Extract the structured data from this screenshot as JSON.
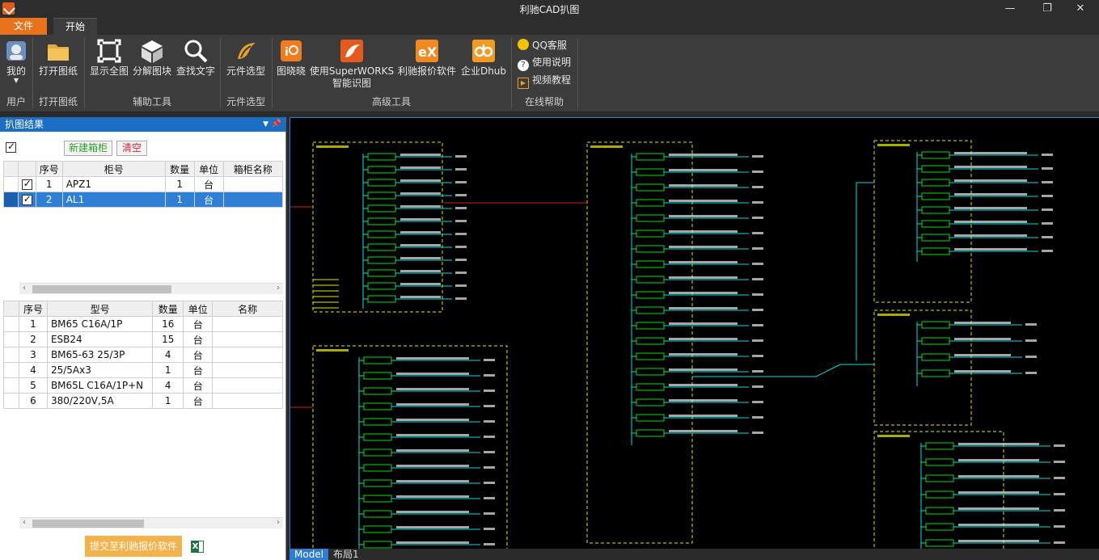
{
  "window": {
    "title": "利驰CAD扒图",
    "minimize": "—",
    "restore": "❐",
    "close": "✕"
  },
  "tabs": {
    "file": "文件",
    "start": "开始"
  },
  "ribbon": {
    "user": {
      "label": "我的",
      "group": "用户"
    },
    "open": {
      "label": "打开图纸",
      "group": "打开图纸"
    },
    "aux": {
      "show_all": "显示全图",
      "explode": "分解图块",
      "find_text": "查找文字",
      "group": "辅助工具"
    },
    "component": {
      "label": "元件选型",
      "group": "元件选型"
    },
    "advanced": {
      "tuxiaoxiao": "图晓晓",
      "superworks": "使用SuperWORKS",
      "superworks2": "智能识图",
      "quote": "利驰报价软件",
      "dhub": "企业Dhub",
      "group": "高级工具"
    },
    "help": {
      "qq": "QQ客服",
      "manual": "使用说明",
      "video": "视频教程",
      "group": "在线帮助"
    }
  },
  "panel": {
    "title": "扒图结果",
    "new_box": "新建箱柜",
    "clear": "清空",
    "cabinet_headers": [
      "序号",
      "柜号",
      "数量",
      "单位",
      "箱柜名称"
    ],
    "cabinets": [
      {
        "no": "1",
        "name": "APZ1",
        "qty": "1",
        "unit": "台",
        "box": ""
      },
      {
        "no": "2",
        "name": "AL1",
        "qty": "1",
        "unit": "台",
        "box": ""
      }
    ],
    "item_headers": [
      "序号",
      "型号",
      "数量",
      "单位",
      "名称"
    ],
    "items": [
      {
        "no": "1",
        "model": "BM65 C16A/1P",
        "qty": "16",
        "unit": "台",
        "name": ""
      },
      {
        "no": "2",
        "model": "ESB24",
        "qty": "15",
        "unit": "台",
        "name": ""
      },
      {
        "no": "3",
        "model": "BM65-63 25/3P",
        "qty": "4",
        "unit": "台",
        "name": ""
      },
      {
        "no": "4",
        "model": "25/5Ax3",
        "qty": "1",
        "unit": "台",
        "name": ""
      },
      {
        "no": "5",
        "model": "BM65L C16A/1P+N",
        "qty": "4",
        "unit": "台",
        "name": ""
      },
      {
        "no": "6",
        "model": "380/220V,5A",
        "qty": "1",
        "unit": "台",
        "name": ""
      }
    ],
    "submit": "提交至利驰报价软件"
  },
  "layout_tabs": {
    "model": "Model",
    "layout1": "布局1"
  },
  "colors": {
    "accent": "#e8731a",
    "panel_header": "#1a6fc4",
    "selection": "#2f7fd6",
    "cad_yellow": "#e6e600",
    "cad_green": "#00e000",
    "cad_cyan": "#00e0e0"
  }
}
